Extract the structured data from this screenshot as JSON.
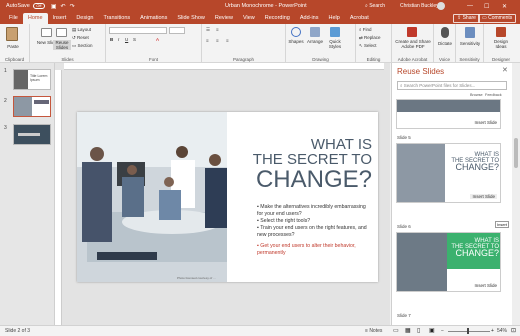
{
  "titlebar": {
    "autosave": "AutoSave",
    "autosave_state": "Off",
    "doc_title": "Urban Monochrome",
    "app_name": "PowerPoint",
    "search": "Search",
    "user": "Christian Buckley"
  },
  "tabs": [
    "File",
    "Home",
    "Insert",
    "Design",
    "Transitions",
    "Animations",
    "Slide Show",
    "Review",
    "View",
    "Recording",
    "Add-ins",
    "Help",
    "Acrobat"
  ],
  "active_tab": "Home",
  "share_label": "Share",
  "comments_label": "Comments",
  "ribbon": {
    "paste": "Paste",
    "clipboard": "Clipboard",
    "new_slide": "New Slide",
    "reuse_slides": "Reuse Slides",
    "layout": "Layout",
    "reset": "Reset",
    "section": "Section",
    "slides": "Slides",
    "font": "Font",
    "paragraph": "Paragraph",
    "shapes": "Shapes",
    "arrange": "Arrange",
    "quick_styles": "Quick Styles",
    "drawing": "Drawing",
    "find": "Find",
    "replace": "Replace",
    "select": "Select",
    "editing": "Editing",
    "create_share": "Create and Share Adobe PDF",
    "adobe_acrobat": "Adobe Acrobat",
    "dictate": "Dictate",
    "voice": "Voice",
    "sensitivity": "Sensitivity",
    "sensitivity_grp": "Sensitivity",
    "design_ideas": "Design Ideas",
    "designer": "Designer"
  },
  "thumbnails": [
    {
      "num": "1",
      "title": "Title Lorem Ipsum"
    },
    {
      "num": "2",
      "title": ""
    },
    {
      "num": "3",
      "title": ""
    }
  ],
  "slide": {
    "title_line1": "WHAT IS",
    "title_line2": "THE SECRET TO",
    "title_line3": "CHANGE?",
    "bullets": [
      "Make the alternatives incredibly embarrassing for your end users?",
      "Select the right tools?",
      "Train your end users on the right features, and new processes?"
    ],
    "highlight": "Get your end users to alter their behavior, permanently",
    "photo_credit": "Photo licensed courtesy of ..."
  },
  "reuse_pane": {
    "title": "Reuse Slides",
    "search_placeholder": "Search PowerPoint files for Slides...",
    "browse": "Browse",
    "feedback": "Feedback",
    "insert_slide": "Insert Slide",
    "tooltip": "Insert",
    "slides": [
      {
        "label": "Slide 5"
      },
      {
        "label": "Slide 6",
        "title": "WHAT IS THE SECRET TO CHANGE?"
      },
      {
        "label": "Slide 7",
        "title": "WHAT IS THE SECRET TO CHANGE?"
      }
    ]
  },
  "status": {
    "slide_of": "Slide 2 of 3",
    "notes": "Notes",
    "zoom": "54%"
  },
  "colors": {
    "brand": "#b7472a",
    "slide_title": "#4a5a6a",
    "highlight": "#c0392b",
    "green": "#3bb16e"
  }
}
